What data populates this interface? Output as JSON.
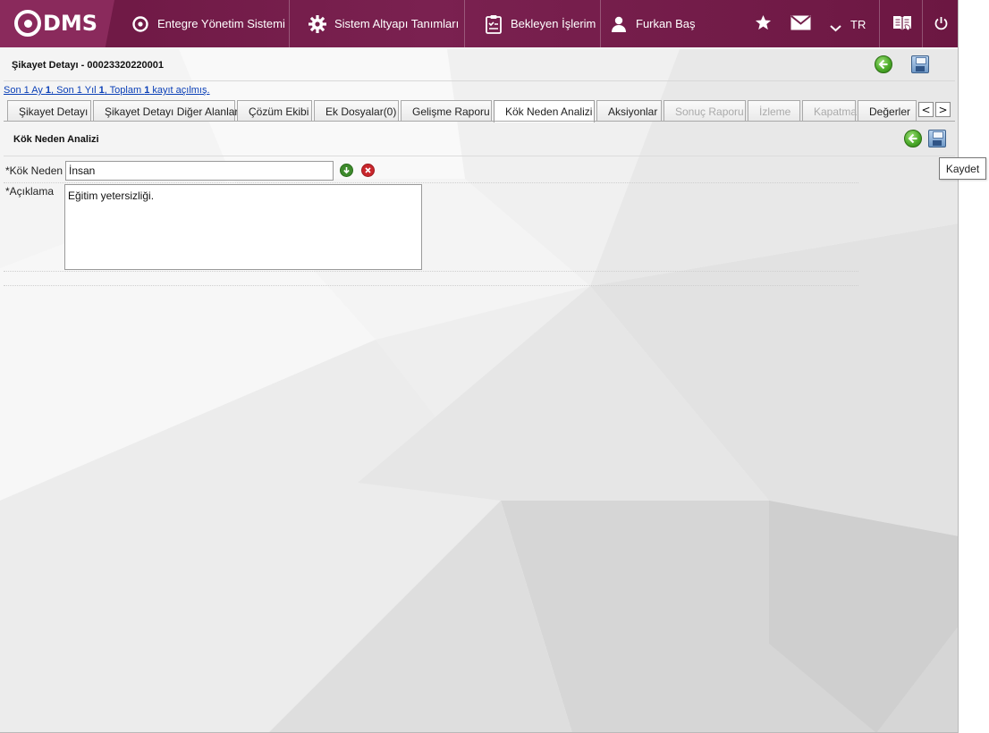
{
  "brand": {
    "logo_text": "DMS"
  },
  "nav": {
    "items": [
      {
        "label": "Entegre Yönetim Sistemi",
        "icon": "qdms-circle-icon"
      },
      {
        "label": "Sistem Altyapı Tanımları",
        "icon": "gear-icon"
      },
      {
        "label": "Bekleyen İşlerim",
        "icon": "clipboard-icon"
      },
      {
        "label": "Furkan Baş",
        "icon": "user-icon"
      }
    ],
    "language": "TR",
    "icons": [
      "star-icon",
      "mail-icon",
      "chevron-down-icon",
      "book-icon",
      "power-icon"
    ]
  },
  "header": {
    "title": "Şikayet Detayı - 00023320220001",
    "back_icon": "back-arrow-icon",
    "save_icon": "save-icon"
  },
  "info": {
    "t1": "Son 1 Ay ",
    "v1": "1",
    "t2": ", Son 1 Yıl ",
    "v2": "1",
    "t3": ", Toplam ",
    "v3": "1",
    "t4": " kayıt açılmış."
  },
  "tabs": [
    {
      "label": "Şikayet Detayı",
      "state": "normal"
    },
    {
      "label": "Şikayet Detayı Diğer Alanlar",
      "state": "normal"
    },
    {
      "label": "Çözüm Ekibi",
      "state": "normal"
    },
    {
      "label": "Ek Dosyalar(0)",
      "state": "normal"
    },
    {
      "label": "Gelişme Raporu",
      "state": "normal"
    },
    {
      "label": "Kök Neden Analizi",
      "state": "active"
    },
    {
      "label": "Aksiyonlar",
      "state": "normal"
    },
    {
      "label": "Sonuç Raporu",
      "state": "disabled"
    },
    {
      "label": "İzleme",
      "state": "disabled"
    },
    {
      "label": "Kapatma",
      "state": "disabled"
    },
    {
      "label": "Değerler",
      "state": "normal"
    }
  ],
  "tab_nav": {
    "prev": "<",
    "next": ">"
  },
  "panel": {
    "title": "Kök Neden Analizi",
    "fields": {
      "root_cause_label": "*Kök Neden",
      "root_cause_value": "İnsan",
      "description_label": "*Açıklama",
      "description_value": "Eğitim yetersizliği."
    },
    "tooltip": "Kaydet"
  },
  "colors": {
    "topbar": "#6e1a45",
    "accent_green": "#4caa2a",
    "link": "#0a3fb7"
  }
}
